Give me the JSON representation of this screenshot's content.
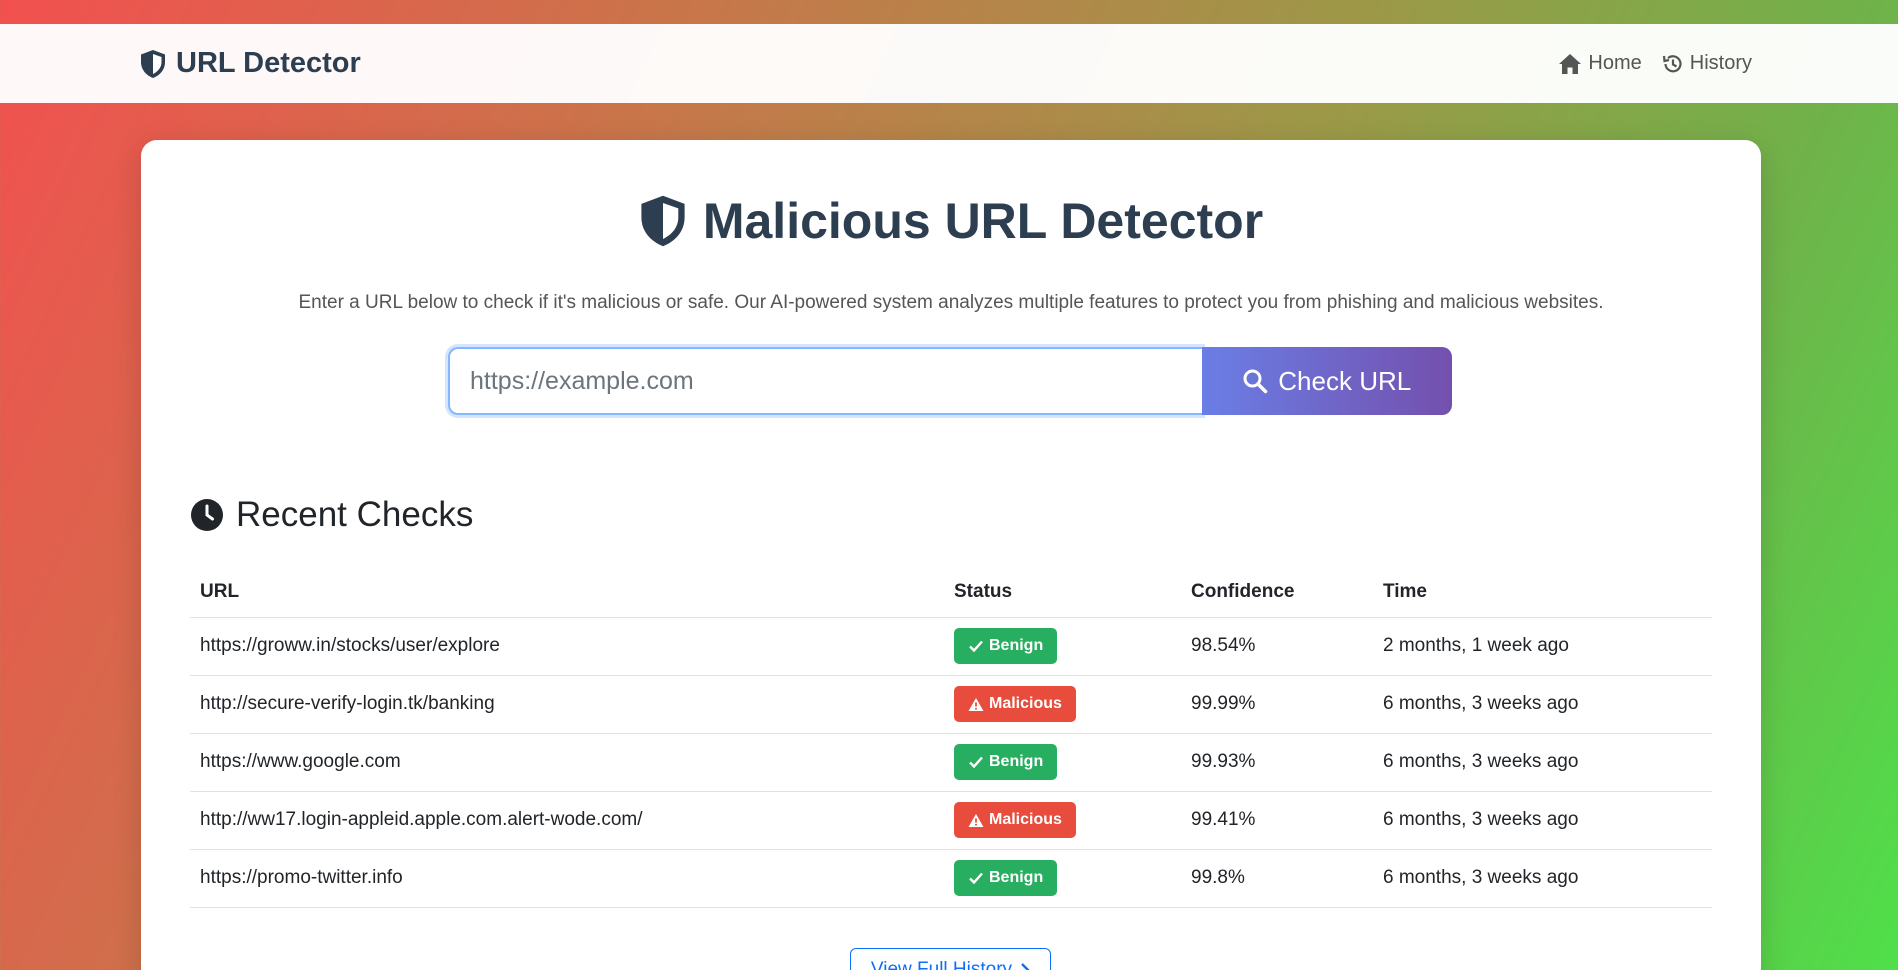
{
  "navbar": {
    "brand": "URL Detector",
    "home": "Home",
    "history": "History"
  },
  "hero": {
    "title": "Malicious URL Detector",
    "subtitle": "Enter a URL below to check if it's malicious or safe. Our AI-powered system analyzes multiple features to protect you from phishing and malicious websites."
  },
  "search": {
    "placeholder": "https://example.com",
    "button": "Check URL"
  },
  "recent": {
    "title": "Recent Checks",
    "headers": {
      "url": "URL",
      "status": "Status",
      "confidence": "Confidence",
      "time": "Time"
    },
    "rows": [
      {
        "url": "https://groww.in/stocks/user/explore",
        "status": "Benign",
        "confidence": "98.54%",
        "time": "2 months, 1 week ago"
      },
      {
        "url": "http://secure-verify-login.tk/banking",
        "status": "Malicious",
        "confidence": "99.99%",
        "time": "6 months, 3 weeks ago"
      },
      {
        "url": "https://www.google.com",
        "status": "Benign",
        "confidence": "99.93%",
        "time": "6 months, 3 weeks ago"
      },
      {
        "url": "http://ww17.login-appleid.apple.com.alert-wode.com/",
        "status": "Malicious",
        "confidence": "99.41%",
        "time": "6 months, 3 weeks ago"
      },
      {
        "url": "https://promo-twitter.info",
        "status": "Benign",
        "confidence": "99.8%",
        "time": "6 months, 3 weeks ago"
      }
    ],
    "view_all": "View Full History"
  },
  "colors": {
    "benign": "#27ae60",
    "malicious": "#e74c3c",
    "heading": "#2c3e50",
    "button_start": "#6a7ee6",
    "button_end": "#7450ad"
  },
  "icons": {
    "brand": "shield-icon",
    "home": "home-icon",
    "history": "history-icon",
    "search": "search-icon",
    "recent": "clock-icon",
    "benign": "check-icon",
    "malicious": "warning-icon",
    "view_all": "chevron-right-icon"
  }
}
